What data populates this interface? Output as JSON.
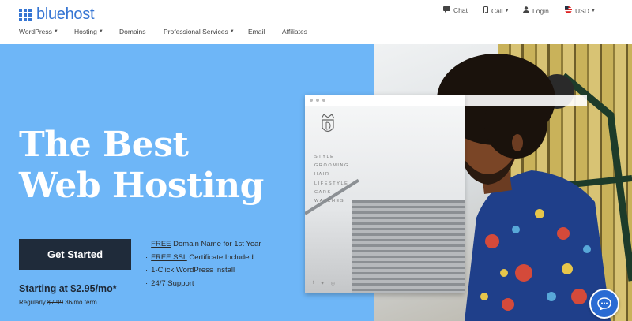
{
  "brand": {
    "name": "bluehost",
    "color": "#3575d3"
  },
  "utility": {
    "chat": "Chat",
    "call": "Call",
    "login": "Login",
    "currency": "USD"
  },
  "nav": {
    "items": [
      {
        "label": "WordPress",
        "dropdown": true
      },
      {
        "label": "Hosting",
        "dropdown": true
      },
      {
        "label": "Domains",
        "dropdown": false
      },
      {
        "label": "Professional Services",
        "dropdown": true
      },
      {
        "label": "Email",
        "dropdown": false
      },
      {
        "label": "Affiliates",
        "dropdown": false
      }
    ]
  },
  "hero": {
    "headline_line1": "The Best",
    "headline_line2": "Web Hosting",
    "cta_label": "Get Started",
    "features": {
      "f1_u": "FREE",
      "f1_rest": " Domain Name for 1st Year",
      "f2_u": "FREE SSL",
      "f2_rest": " Certificate Included",
      "f3": "1-Click WordPress Install",
      "f4": "24/7 Support"
    },
    "price": "Starting at $2.95/mo*",
    "regular_prefix": "Regularly ",
    "regular_price": "$7.99",
    "regular_suffix": " 36/mo term",
    "bg_color": "#6eb6f7",
    "cta_color": "#1f2b3a"
  },
  "mockup": {
    "menu": [
      "STYLE",
      "GROOMING",
      "HAIR",
      "LIFESTYLE",
      "CARS",
      "WATCHES"
    ],
    "social_icons": [
      "facebook-icon",
      "twitter-icon",
      "instagram-icon"
    ]
  },
  "chat_widget": {
    "icon": "chat-bubble-icon",
    "color": "#2a6bd3"
  }
}
